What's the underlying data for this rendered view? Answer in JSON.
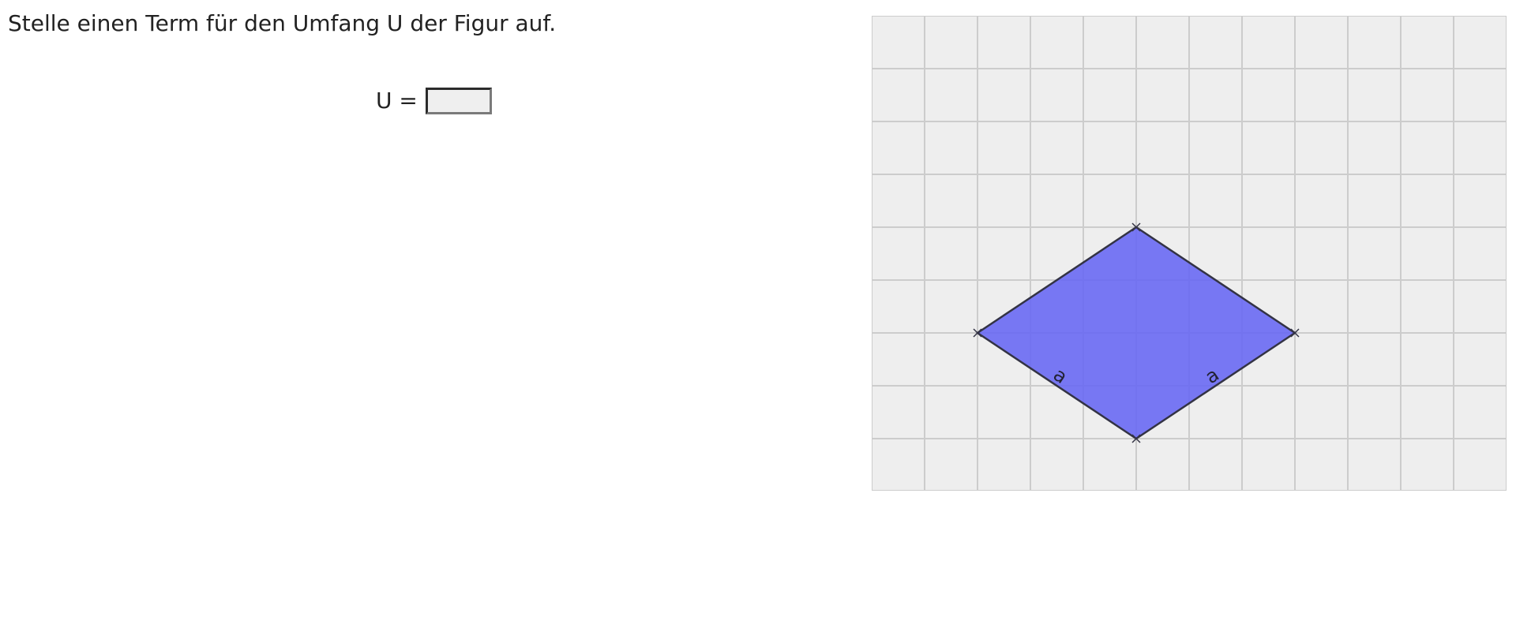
{
  "task": {
    "prompt": "Stelle einen Term für den Umfang U der Figur auf."
  },
  "answer": {
    "label": "U =",
    "value": "",
    "placeholder": ""
  },
  "figure": {
    "shape": "rhombus",
    "side_labels": [
      "a",
      "a"
    ],
    "colors": {
      "background": "#eeeeee",
      "grid": "#cccccc",
      "fill": "#6666f4",
      "outline": "#333344"
    }
  }
}
